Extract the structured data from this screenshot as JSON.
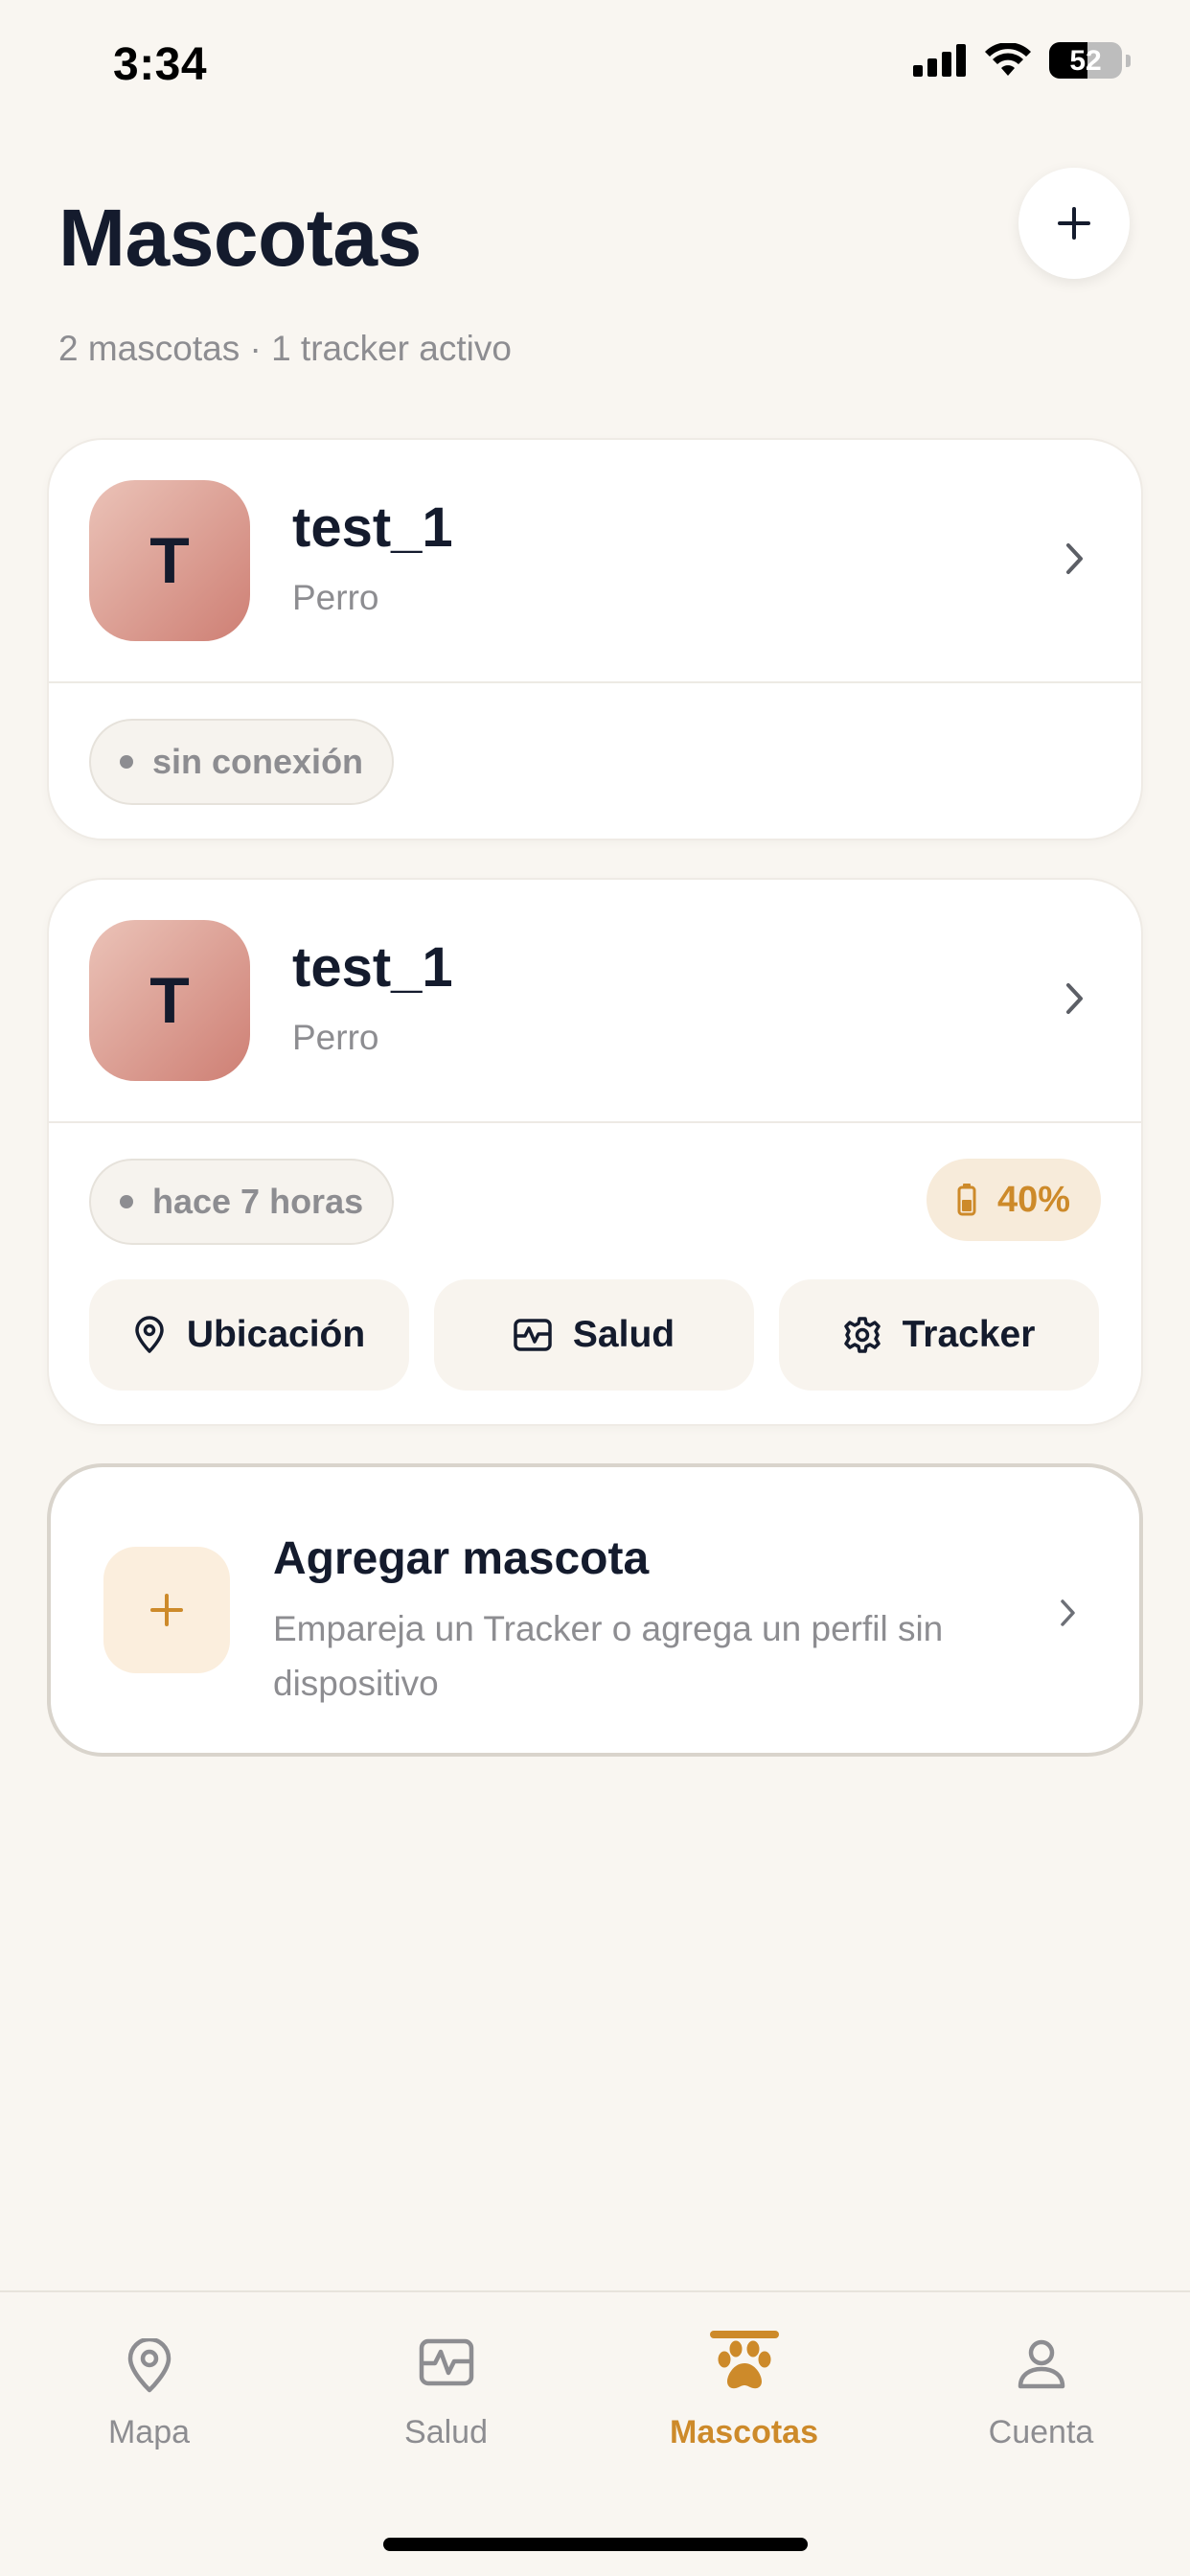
{
  "status_bar": {
    "time": "3:34",
    "battery_level": "52",
    "battery_fraction": 0.52
  },
  "header": {
    "title": "Mascotas",
    "subtitle": "2 mascotas · 1 tracker activo",
    "add_icon": "plus-icon"
  },
  "pets": [
    {
      "initial": "T",
      "name": "test_1",
      "species": "Perro",
      "status": "sin conexión"
    },
    {
      "initial": "T",
      "name": "test_1",
      "species": "Perro",
      "status": "hace 7 horas",
      "battery": "40%",
      "actions": [
        {
          "label": "Ubicación",
          "icon": "location-pin-icon"
        },
        {
          "label": "Salud",
          "icon": "health-chart-icon"
        },
        {
          "label": "Tracker",
          "icon": "gear-icon"
        }
      ]
    }
  ],
  "add_pet": {
    "title": "Agregar mascota",
    "description": "Empareja un Tracker o agrega un perfil sin dispositivo"
  },
  "tabs": [
    {
      "label": "Mapa",
      "icon": "location-pin-icon",
      "active": false
    },
    {
      "label": "Salud",
      "icon": "health-chart-icon",
      "active": false
    },
    {
      "label": "Mascotas",
      "icon": "paw-icon",
      "active": true
    },
    {
      "label": "Cuenta",
      "icon": "user-icon",
      "active": false
    }
  ],
  "colors": {
    "background": "#F9F6F1",
    "accent": "#CD8A2A",
    "text_primary": "#141B2D",
    "text_secondary": "#8D8D91"
  }
}
